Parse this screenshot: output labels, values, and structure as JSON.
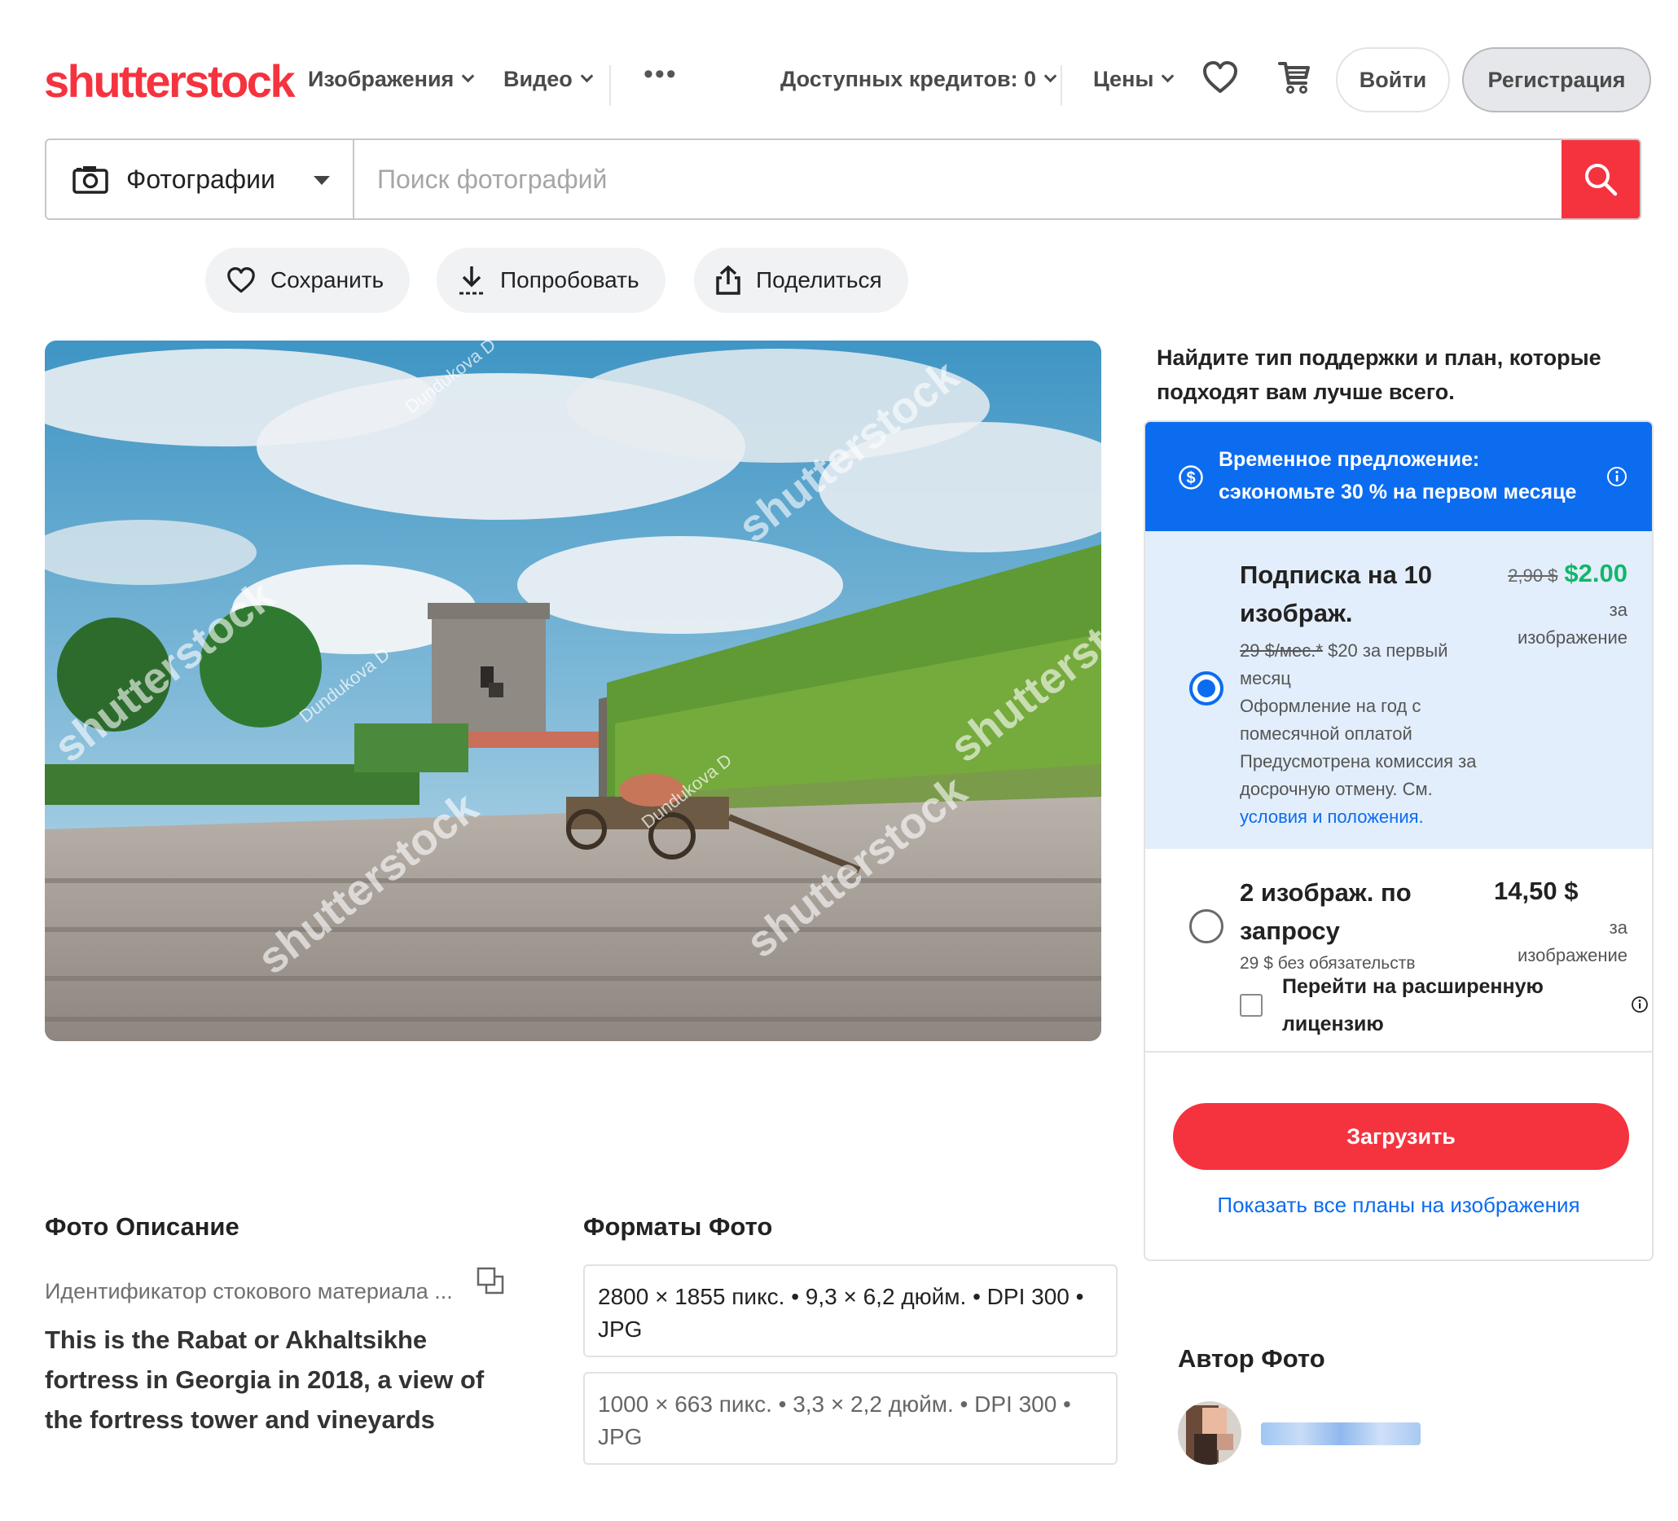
{
  "brand": {
    "logo_text": "shutterstock",
    "accent": "#f5333f",
    "link_blue": "#0b6cf0"
  },
  "header": {
    "nav": [
      {
        "label": "Изображения",
        "icon": "chevron-down-icon"
      },
      {
        "label": "Видео",
        "icon": "chevron-down-icon"
      }
    ],
    "more": "•••",
    "credits_label": "Доступных кредитов: 0",
    "pricing_label": "Цены",
    "icons": [
      "heart-icon",
      "cart-icon"
    ],
    "login_label": "Войти",
    "register_label": "Регистрация"
  },
  "search": {
    "type_label": "Фотографии",
    "placeholder": "Поиск фотографий",
    "value": "",
    "icons": [
      "camera-icon",
      "search-icon"
    ]
  },
  "actions": [
    {
      "label": "Сохранить",
      "icon": "heart-icon"
    },
    {
      "label": "Попробовать",
      "icon": "download-icon"
    },
    {
      "label": "Поделиться",
      "icon": "share-icon"
    }
  ],
  "photo": {
    "watermark": "shutterstock",
    "author_watermark": "Dundukova D"
  },
  "panel": {
    "heading": "Найдите тип поддержки и план, которые подходят вам лучше всего.",
    "offer": {
      "line1": "Временное предложение:",
      "line2": "сэкономьте 30 % на первом месяце",
      "icons": [
        "dollar-icon",
        "info-icon"
      ]
    },
    "plan1": {
      "title_line1": "Подписка на 10",
      "title_line2": "изображ.",
      "old_price": "2,90 $",
      "price": "$2.00",
      "unit_line1": "за",
      "unit_line2": "изображение",
      "old_monthly": "29 $/мес.*",
      "monthly_rest": " $20 за первый",
      "monthly_line2": "месяц",
      "note_line1": "Оформление на год с",
      "note_line2": "помесячной оплатой",
      "note_line3": "Предусмотрена комиссия за",
      "note_line4": "досрочную отмену. См.",
      "terms_link": "условия и положения.",
      "selected": true
    },
    "plan2": {
      "title_line1": "2 изображ. по",
      "title_line2": "запросу",
      "price": "14,50 $",
      "unit_line1": "за",
      "unit_line2": "изображение",
      "note": "29 $ без обязательств",
      "extended_line1": "Перейти на расширенную",
      "extended_line2": "лицензию",
      "extended_checked": false,
      "selected": false
    },
    "buy_label": "Загрузить",
    "all_plans_link": "Показать все планы на изображения"
  },
  "description": {
    "title": "Фото Описание",
    "stock_id_label": "Идентификатор стокового материала ...",
    "text_line1": "This is the Rabat or Akhaltsikhe",
    "text_line2": "fortress in Georgia in 2018, a view of",
    "text_line3": "the fortress tower and vineyards"
  },
  "formats": {
    "title": "Форматы Фото",
    "items": [
      {
        "line1": "2800 × 1855 пикс. • 9,3 × 6,2 дюйм. • DPI 300 •",
        "line2": "JPG"
      },
      {
        "line1": "1000 × 663 пикс. • 3,3 × 2,2 дюйм. • DPI 300 •",
        "line2": "JPG"
      }
    ]
  },
  "author": {
    "title": "Автор Фото"
  }
}
